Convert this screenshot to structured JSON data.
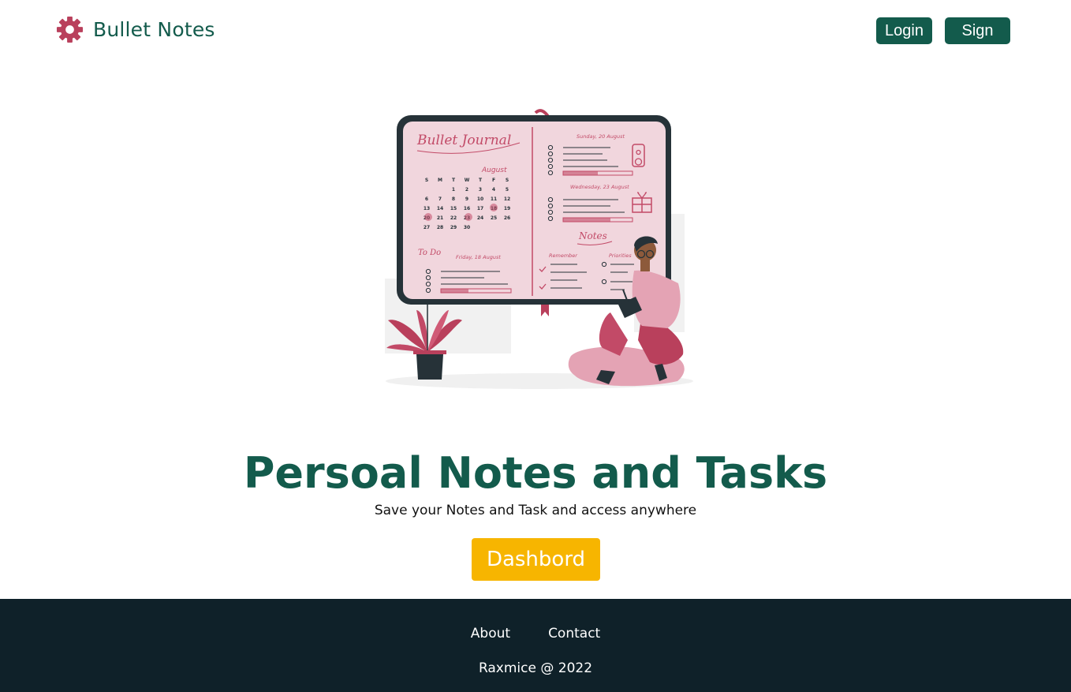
{
  "header": {
    "brand_name": "Bullet Notes",
    "brand_icon": "gear-icon",
    "login_label": "Login",
    "signin_label": "Sign in"
  },
  "illustration": {
    "journal_title": "Bullet Journal",
    "month": "August",
    "weekdays": [
      "S",
      "M",
      "T",
      "W",
      "T",
      "F",
      "S"
    ],
    "calendar_rows": [
      [
        "",
        "",
        "1",
        "2",
        "3",
        "4",
        "5"
      ],
      [
        "6",
        "7",
        "8",
        "9",
        "10",
        "11",
        "12"
      ],
      [
        "13",
        "14",
        "15",
        "16",
        "17",
        "18",
        "19"
      ],
      [
        "20",
        "21",
        "22",
        "23",
        "24",
        "25",
        "26"
      ],
      [
        "27",
        "28",
        "29",
        "30",
        "",
        "",
        ""
      ]
    ],
    "todo_label": "To Do",
    "todo_date": "Friday, 18 August",
    "day1_label": "Sunday, 20 August",
    "day2_label": "Wednesday, 23 August",
    "notes_label": "Notes",
    "remember_label": "Remember",
    "priorities_label": "Priorities"
  },
  "hero": {
    "title": "Persoal Notes and Tasks",
    "subtitle": "Save your Notes and Task and access anywhere",
    "dashboard_label": "Dashbord"
  },
  "footer": {
    "about_label": "About",
    "contact_label": "Contact",
    "copyright": "Raxmice @ 2022"
  },
  "colors": {
    "primary": "#135b4c",
    "accent": "#f7b500",
    "icon": "#b9405c",
    "footer_bg": "#0f2129"
  }
}
